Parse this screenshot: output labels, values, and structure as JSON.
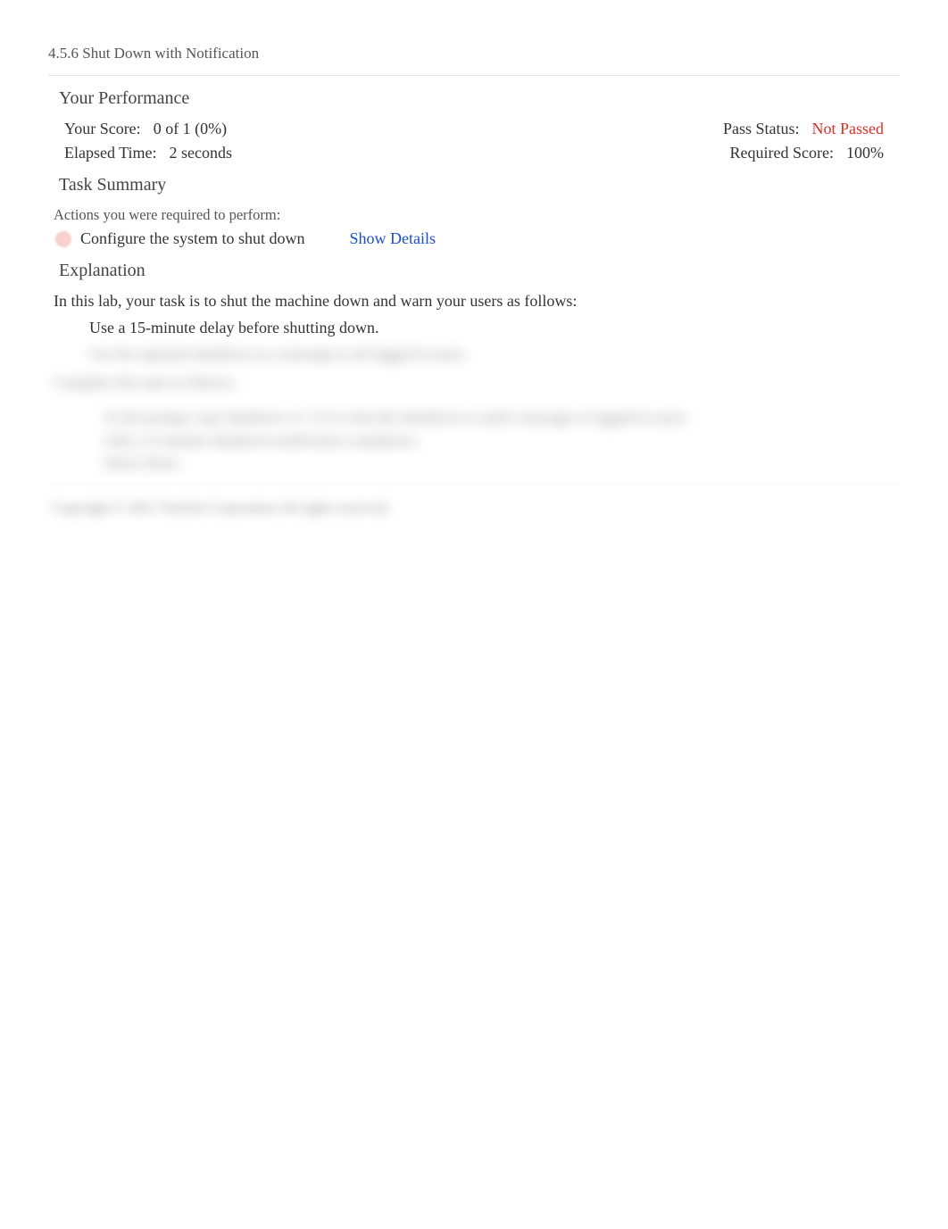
{
  "title": "4.5.6 Shut Down with Notification",
  "performance": {
    "heading": "Your Performance",
    "score_label": "Your Score:",
    "score_value": "0 of 1 (0%)",
    "elapsed_label": "Elapsed Time:",
    "elapsed_value": "2 seconds",
    "pass_status_label": "Pass Status:",
    "pass_status_value": "Not Passed",
    "required_score_label": "Required Score:",
    "required_score_value": "100%"
  },
  "task_summary": {
    "heading": "Task Summary",
    "actions_label": "Actions you were required to perform:",
    "items": [
      {
        "text": "Configure the system to shut down",
        "details_link": "Show Details"
      }
    ]
  },
  "explanation": {
    "heading": "Explanation",
    "intro": "In this lab, your task is to shut the machine down and warn your users as follows:",
    "bullet1_pre": "Use a ",
    "bullet1_mid": "15-minute",
    "bullet1_post": " delay before shutting down.",
    "blurred_bullet2": "Use the optional shutdown as a message to all logged in users.",
    "blurred_complete": "Complete this task as follows:",
    "blurred_step1": "At the prompt, type shutdown -h +15 to start the shutdown to send a message to logged-in users.",
    "blurred_step1b": "with a 15-minute shutdown notification countdown.",
    "blurred_step2": "Select Done.",
    "copyright": "Copyright © 2021 TestOut Corporation All rights reserved."
  }
}
